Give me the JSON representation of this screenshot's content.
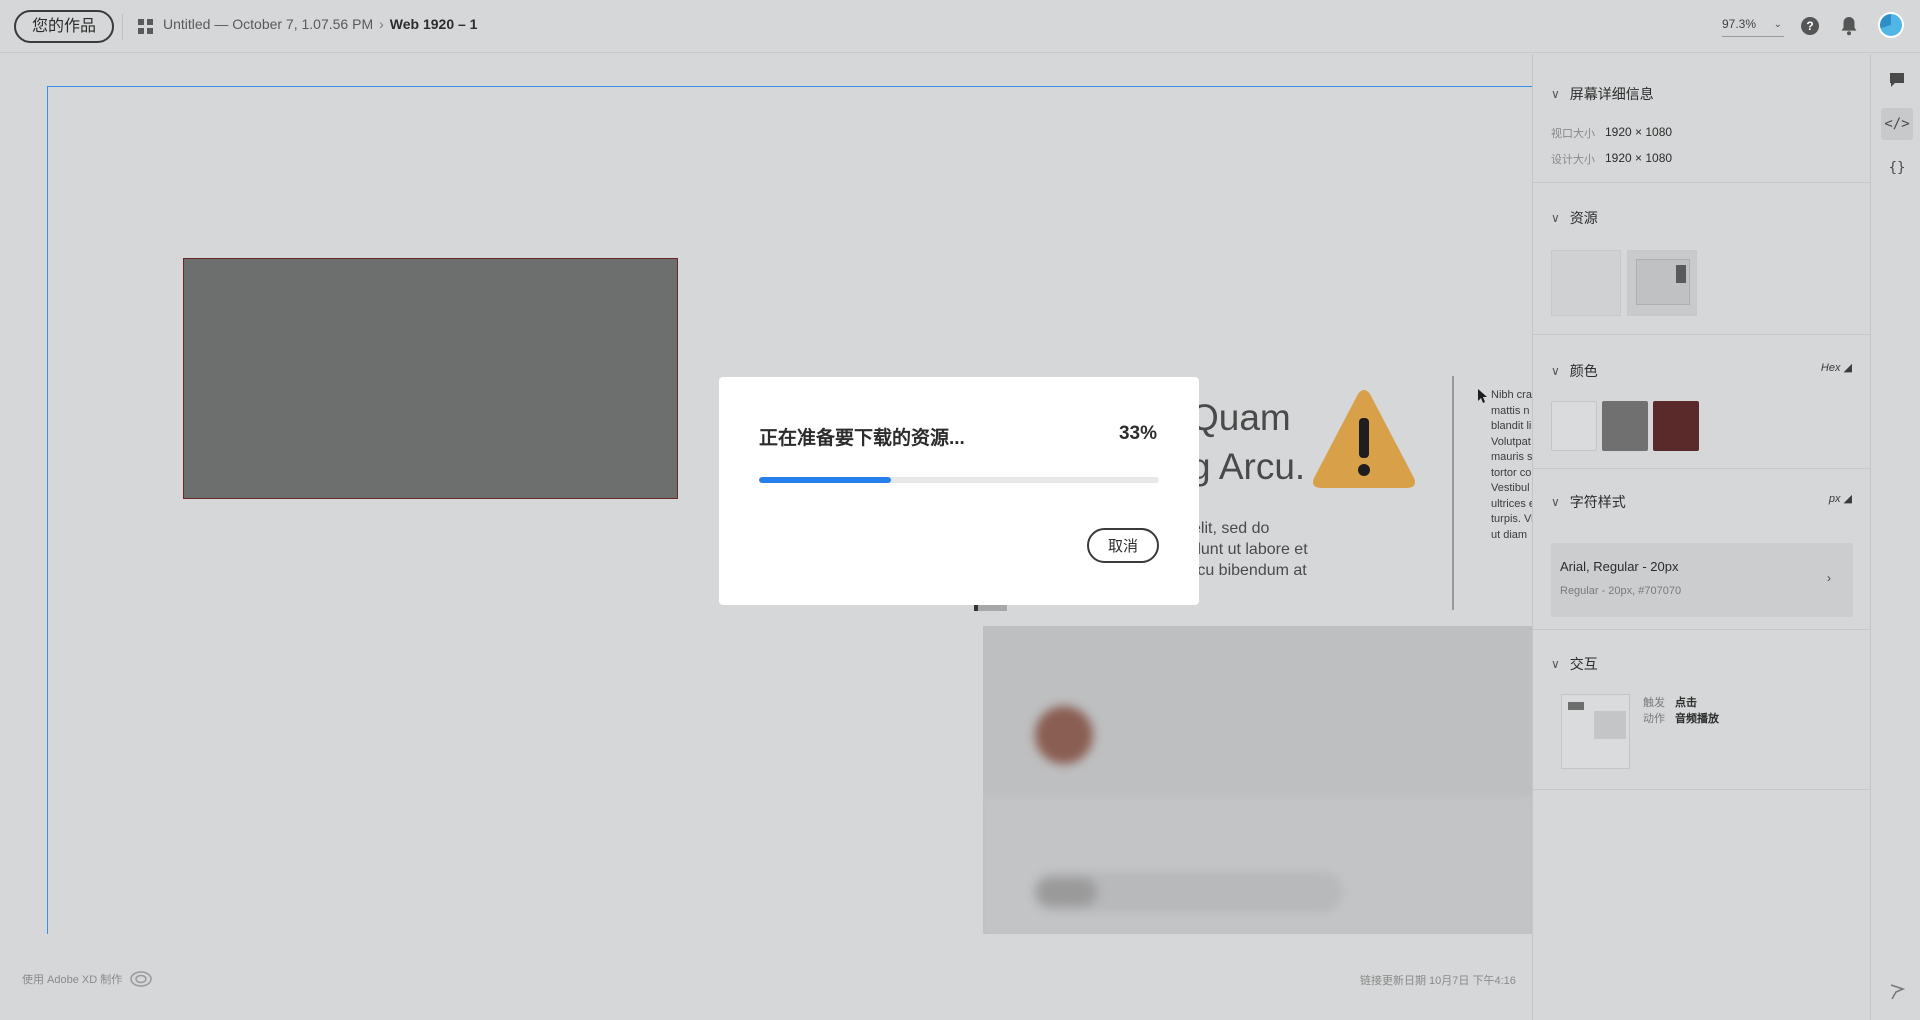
{
  "topbar": {
    "works_button": "您的作品",
    "doc_title": "Untitled — October 7, 1.07.56 PM",
    "artboard_name": "Web 1920 – 1",
    "zoom": "97.3%"
  },
  "canvas": {
    "headline_line1": "Quam",
    "headline_line2": "g Arcu.",
    "para_lines": [
      "elit, sed do",
      "dunt ut labore et",
      "rcu bibendum at"
    ],
    "side_lines": [
      "Nibh cra",
      "mattis n",
      "blandit li",
      "Volutpat",
      "mauris s",
      "tortor co",
      "Vestibul",
      "ultrices e",
      "turpis. Vi",
      "ut diam"
    ]
  },
  "footer": {
    "made_with": "使用 Adobe XD 制作",
    "updated": "链接更新日期 10月7日 下午4:16"
  },
  "dialog": {
    "title": "正在准备要下载的资源...",
    "percent_label": "33%",
    "progress": 0.33,
    "cancel_label": "取消"
  },
  "panel": {
    "screen": {
      "title": "屏幕详细信息",
      "viewport_label": "视口大小",
      "viewport_value": "1920 × 1080",
      "design_label": "设计大小",
      "design_value": "1920 × 1080"
    },
    "assets": {
      "title": "资源"
    },
    "colors": {
      "title": "颜色",
      "format": "Hex",
      "swatches": [
        "#d9dbdc",
        "#707070",
        "#5a2a2a"
      ]
    },
    "char_styles": {
      "title": "字符样式",
      "unit": "px",
      "main": "Arial, Regular - 20px",
      "sub": "Regular - 20px, #707070"
    },
    "interaction": {
      "title": "交互",
      "trigger_label": "触发",
      "trigger_value": "点击",
      "action_label": "动作",
      "action_value": "音频播放"
    }
  },
  "colors": {
    "accent": "#2680eb",
    "warning": "#d9a04a"
  }
}
